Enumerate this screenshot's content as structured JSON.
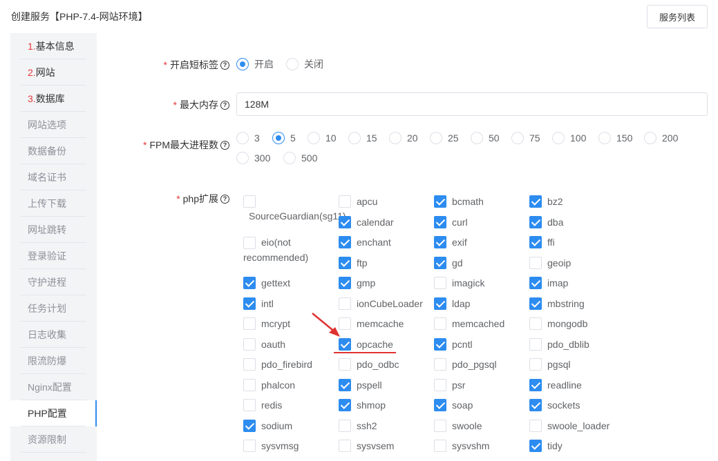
{
  "header": {
    "title": "创建服务【PHP-7.4-网站环境】",
    "services_button": "服务列表"
  },
  "sidebar": {
    "items": [
      {
        "num": "1.",
        "label": "基本信息"
      },
      {
        "num": "2.",
        "label": "网站"
      },
      {
        "num": "3.",
        "label": "数据库"
      },
      {
        "num": "",
        "label": "网站选项"
      },
      {
        "num": "",
        "label": "数据备份"
      },
      {
        "num": "",
        "label": "域名证书"
      },
      {
        "num": "",
        "label": "上传下载"
      },
      {
        "num": "",
        "label": "网址跳转"
      },
      {
        "num": "",
        "label": "登录验证"
      },
      {
        "num": "",
        "label": "守护进程"
      },
      {
        "num": "",
        "label": "任务计划"
      },
      {
        "num": "",
        "label": "日志收集"
      },
      {
        "num": "",
        "label": "限流防爆"
      },
      {
        "num": "",
        "label": "Nginx配置"
      },
      {
        "num": "",
        "label": "PHP配置"
      },
      {
        "num": "",
        "label": "资源限制"
      }
    ],
    "active": "PHP配置"
  },
  "form": {
    "short_tag": {
      "label": "开启短标签",
      "options": [
        "开启",
        "关闭"
      ],
      "selected": "开启"
    },
    "max_memory": {
      "label": "最大内存",
      "value": "128M"
    },
    "fpm": {
      "label": "FPM最大进程数",
      "options": [
        "3",
        "5",
        "10",
        "15",
        "20",
        "25",
        "50",
        "75",
        "100",
        "150",
        "200",
        "300",
        "500"
      ],
      "selected": "5"
    },
    "php_ext": {
      "label": "php扩展",
      "items": [
        {
          "name": "SourceGuardian(sg11)",
          "checked": false
        },
        {
          "name": "apcu",
          "checked": false
        },
        {
          "name": "bcmath",
          "checked": true
        },
        {
          "name": "bz2",
          "checked": true
        },
        {
          "name": "calendar",
          "checked": true
        },
        {
          "name": "curl",
          "checked": true
        },
        {
          "name": "dba",
          "checked": true
        },
        {
          "name": "eio(not recommended)",
          "checked": false
        },
        {
          "name": "enchant",
          "checked": true
        },
        {
          "name": "exif",
          "checked": true
        },
        {
          "name": "ffi",
          "checked": true
        },
        {
          "name": "ftp",
          "checked": true
        },
        {
          "name": "gd",
          "checked": true
        },
        {
          "name": "geoip",
          "checked": false
        },
        {
          "name": "gettext",
          "checked": true
        },
        {
          "name": "gmp",
          "checked": true
        },
        {
          "name": "imagick",
          "checked": false
        },
        {
          "name": "imap",
          "checked": true
        },
        {
          "name": "intl",
          "checked": true
        },
        {
          "name": "ionCubeLoader",
          "checked": false
        },
        {
          "name": "ldap",
          "checked": true
        },
        {
          "name": "mbstring",
          "checked": true
        },
        {
          "name": "mcrypt",
          "checked": false
        },
        {
          "name": "memcache",
          "checked": false
        },
        {
          "name": "memcached",
          "checked": false
        },
        {
          "name": "mongodb",
          "checked": false
        },
        {
          "name": "oauth",
          "checked": false
        },
        {
          "name": "opcache",
          "checked": true
        },
        {
          "name": "pcntl",
          "checked": true
        },
        {
          "name": "pdo_dblib",
          "checked": false
        },
        {
          "name": "pdo_firebird",
          "checked": false
        },
        {
          "name": "pdo_odbc",
          "checked": false
        },
        {
          "name": "pdo_pgsql",
          "checked": false
        },
        {
          "name": "pgsql",
          "checked": false
        },
        {
          "name": "phalcon",
          "checked": false
        },
        {
          "name": "pspell",
          "checked": true
        },
        {
          "name": "psr",
          "checked": false
        },
        {
          "name": "readline",
          "checked": true
        },
        {
          "name": "redis",
          "checked": false
        },
        {
          "name": "shmop",
          "checked": true
        },
        {
          "name": "soap",
          "checked": true
        },
        {
          "name": "sockets",
          "checked": true
        },
        {
          "name": "sodium",
          "checked": true
        },
        {
          "name": "ssh2",
          "checked": false
        },
        {
          "name": "swoole",
          "checked": false
        },
        {
          "name": "swoole_loader",
          "checked": false
        },
        {
          "name": "sysvmsg",
          "checked": false
        },
        {
          "name": "sysvsem",
          "checked": false
        },
        {
          "name": "sysvshm",
          "checked": false
        },
        {
          "name": "tidy",
          "checked": true
        }
      ]
    }
  },
  "colors": {
    "accent": "#2d8cf0",
    "required": "#e4393c",
    "annotation": "#e03131"
  }
}
